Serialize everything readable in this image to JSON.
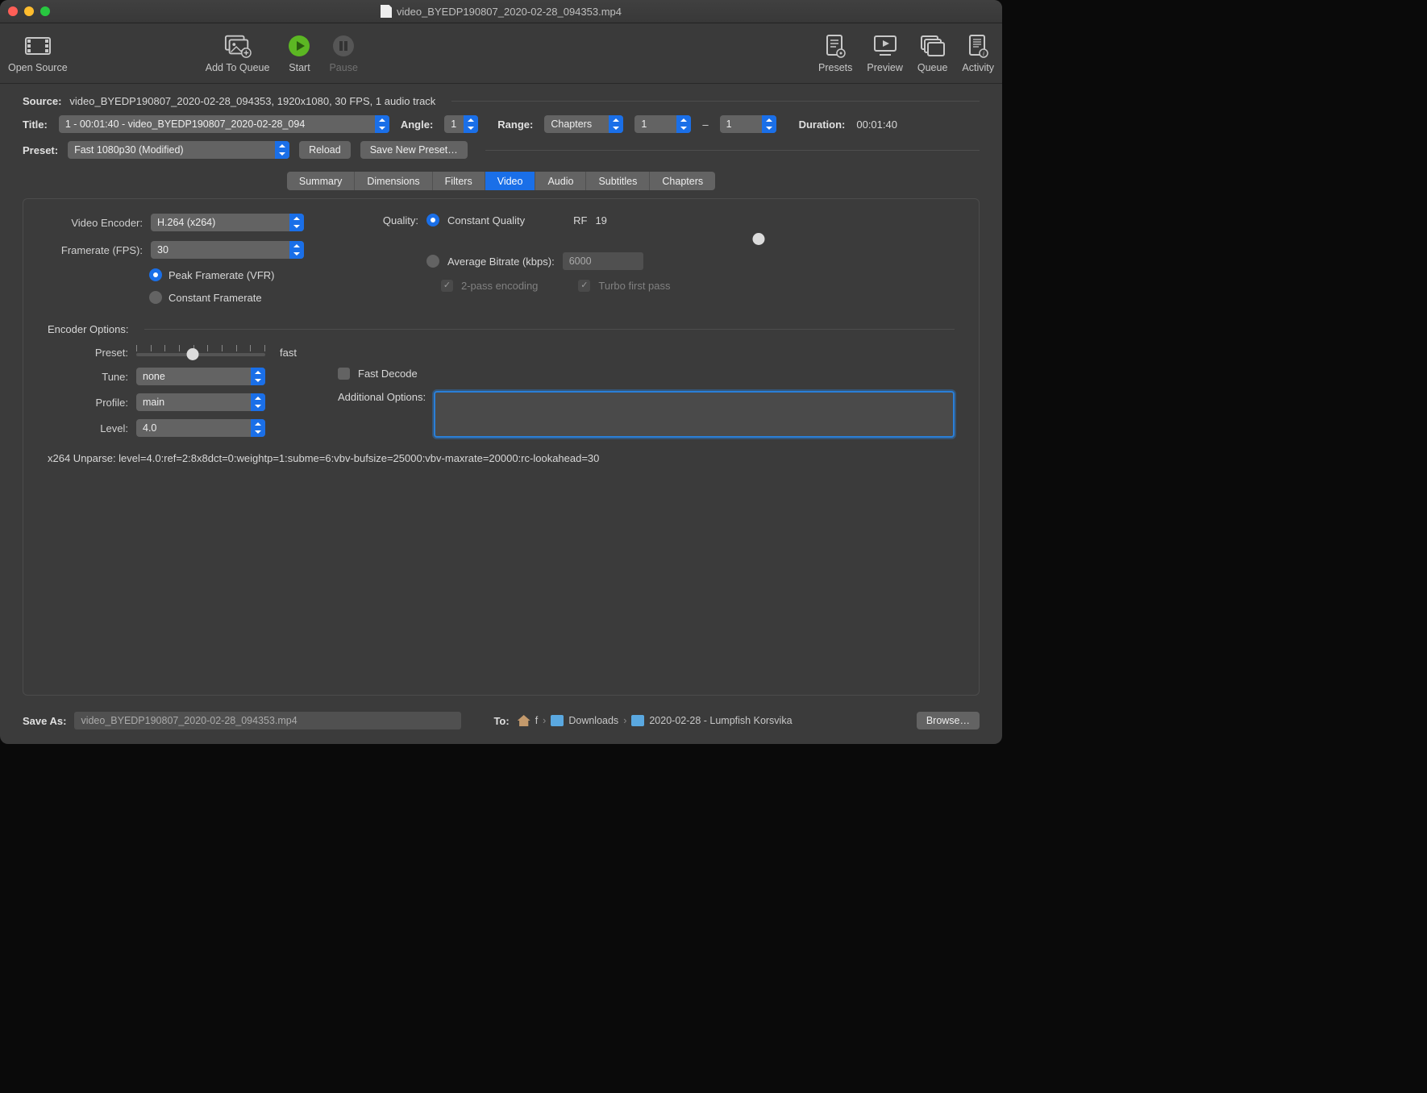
{
  "window_title": "video_BYEDP190807_2020-02-28_094353.mp4",
  "toolbar": {
    "open_source": "Open Source",
    "add_to_queue": "Add To Queue",
    "start": "Start",
    "pause": "Pause",
    "presets": "Presets",
    "preview": "Preview",
    "queue": "Queue",
    "activity": "Activity"
  },
  "source": {
    "label": "Source:",
    "value": "video_BYEDP190807_2020-02-28_094353, 1920x1080, 30 FPS, 1 audio track"
  },
  "title_row": {
    "title_label": "Title:",
    "title_value": "1 - 00:01:40 - video_BYEDP190807_2020-02-28_094",
    "angle_label": "Angle:",
    "angle_value": "1",
    "range_label": "Range:",
    "range_mode": "Chapters",
    "range_start": "1",
    "range_sep": "–",
    "range_end": "1",
    "duration_label": "Duration:",
    "duration_value": "00:01:40"
  },
  "preset_row": {
    "preset_label": "Preset:",
    "preset_value": "Fast 1080p30 (Modified)",
    "reload": "Reload",
    "save_new": "Save New Preset…"
  },
  "tabs": [
    "Summary",
    "Dimensions",
    "Filters",
    "Video",
    "Audio",
    "Subtitles",
    "Chapters"
  ],
  "active_tab": "Video",
  "video": {
    "encoder_label": "Video Encoder:",
    "encoder_value": "H.264 (x264)",
    "framerate_label": "Framerate (FPS):",
    "framerate_value": "30",
    "peak_framerate": "Peak Framerate (VFR)",
    "constant_framerate": "Constant Framerate",
    "quality_label": "Quality:",
    "constant_quality": "Constant Quality",
    "rf_label": "RF",
    "rf_value": "19",
    "avg_bitrate_label": "Average Bitrate (kbps):",
    "avg_bitrate_value": "6000",
    "two_pass": "2-pass encoding",
    "turbo": "Turbo first pass",
    "encoder_options_label": "Encoder Options:",
    "preset_label": "Preset:",
    "preset_speed": "fast",
    "tune_label": "Tune:",
    "tune_value": "none",
    "fast_decode": "Fast Decode",
    "profile_label": "Profile:",
    "profile_value": "main",
    "additional_options_label": "Additional Options:",
    "additional_options_value": "",
    "level_label": "Level:",
    "level_value": "4.0",
    "unparse": "x264 Unparse: level=4.0:ref=2:8x8dct=0:weightp=1:subme=6:vbv-bufsize=25000:vbv-maxrate=20000:rc-lookahead=30"
  },
  "footer": {
    "save_as_label": "Save As:",
    "save_as_value": "video_BYEDP190807_2020-02-28_094353.mp4",
    "to_label": "To:",
    "path_user": "f",
    "path_downloads": "Downloads",
    "path_folder": "2020-02-28 - Lumpfish Korsvika",
    "browse": "Browse…"
  }
}
